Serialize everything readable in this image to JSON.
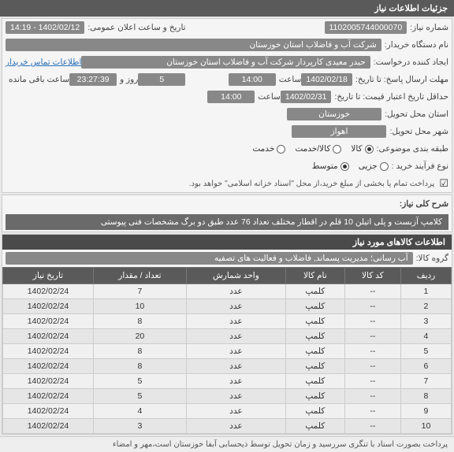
{
  "header": {
    "title": "جزئیات اطلاعات نیاز"
  },
  "fields": {
    "need_number_label": "شماره نیاز:",
    "need_number": "1102005744000070",
    "announce_label": "تاریخ و ساعت اعلان عمومی:",
    "announce_value": "1402/02/12 - 14:19",
    "buyer_org_label": "نام دستگاه خریدار:",
    "buyer_org": "شرکت آب و فاضلاب استان خوزستان",
    "requester_label": "ایجاد کننده درخواست:",
    "requester": "حیدر معیدی کارپرداز شرکت آب و فاضلاب استان خوزستان",
    "buyer_contact_link": "اطلاعات تماس خریدار",
    "reply_deadline_label": "مهلت ارسال پاسخ: تا تاریخ:",
    "reply_date": "1402/02/18",
    "time_label": "ساعت",
    "reply_time": "14:00",
    "remaining_days": "5",
    "remaining_label_days": "روز و",
    "remaining_time": "23:27:39",
    "remaining_label_suffix": "ساعت باقی مانده",
    "price_validity_label": "حداقل تاریخ اعتبار قیمت: تا تاریخ:",
    "price_date": "1402/02/31",
    "price_time": "14:00",
    "province_label": "استان محل تحویل:",
    "province": "خوزستان",
    "city_label": "شهر محل تحویل:",
    "city": "اهواز",
    "category_label": "طبقه بندی موضوعی:",
    "cat_goods": "کالا",
    "cat_service": "کالا/خدمت",
    "cat_service_only": "خدمت",
    "purchase_type_label": "نوع فرآیند خرید :",
    "pt_small": "جزیی",
    "pt_medium": "متوسط",
    "payment_note": "پرداخت تمام یا بخشی از مبلغ خرید،از محل \"اسناد خزانه اسلامی\" خواهد بود.",
    "checkbox_icon": "☑"
  },
  "desc": {
    "title_label": "شرح کلی نیاز:",
    "text": "کلامپ آزبست و پلی اتیلن 10 قلم در اقطار مختلف تعداد 76 عدد طبق دو برگ مشخصات فنی پیوستی"
  },
  "goods": {
    "section_title": "اطلاعات کالاهای مورد نیاز",
    "group_label": "گروه کالا:",
    "group_value": "آب رسانی؛ مدیریت پسماند, فاضلاب و فعالیت های تصفیه",
    "columns": {
      "row": "ردیف",
      "code": "کد کالا",
      "name": "نام کالا",
      "unit": "واحد شمارش",
      "qty": "تعداد / مقدار",
      "date": "تاریخ نیاز"
    },
    "rows": [
      {
        "n": "1",
        "code": "--",
        "name": "کلمپ",
        "unit": "عدد",
        "qty": "7",
        "date": "1402/02/24"
      },
      {
        "n": "2",
        "code": "--",
        "name": "کلمپ",
        "unit": "عدد",
        "qty": "10",
        "date": "1402/02/24"
      },
      {
        "n": "3",
        "code": "--",
        "name": "کلمپ",
        "unit": "عدد",
        "qty": "8",
        "date": "1402/02/24"
      },
      {
        "n": "4",
        "code": "--",
        "name": "کلمپ",
        "unit": "عدد",
        "qty": "20",
        "date": "1402/02/24"
      },
      {
        "n": "5",
        "code": "--",
        "name": "کلمپ",
        "unit": "عدد",
        "qty": "8",
        "date": "1402/02/24"
      },
      {
        "n": "6",
        "code": "--",
        "name": "کلمپ",
        "unit": "عدد",
        "qty": "8",
        "date": "1402/02/24"
      },
      {
        "n": "7",
        "code": "--",
        "name": "کلمپ",
        "unit": "عدد",
        "qty": "5",
        "date": "1402/02/24"
      },
      {
        "n": "8",
        "code": "--",
        "name": "کلمپ",
        "unit": "عدد",
        "qty": "5",
        "date": "1402/02/24"
      },
      {
        "n": "9",
        "code": "--",
        "name": "کلمپ",
        "unit": "عدد",
        "qty": "4",
        "date": "1402/02/24"
      },
      {
        "n": "10",
        "code": "--",
        "name": "کلمپ",
        "unit": "عدد",
        "qty": "3",
        "date": "1402/02/24"
      }
    ]
  },
  "footer": {
    "text": "پرداخت بصورت اسناد با تنگری سررسید و زمان تحویل توسط ذیحسابی آبفا خوزستان است،مهر و امضاء"
  }
}
